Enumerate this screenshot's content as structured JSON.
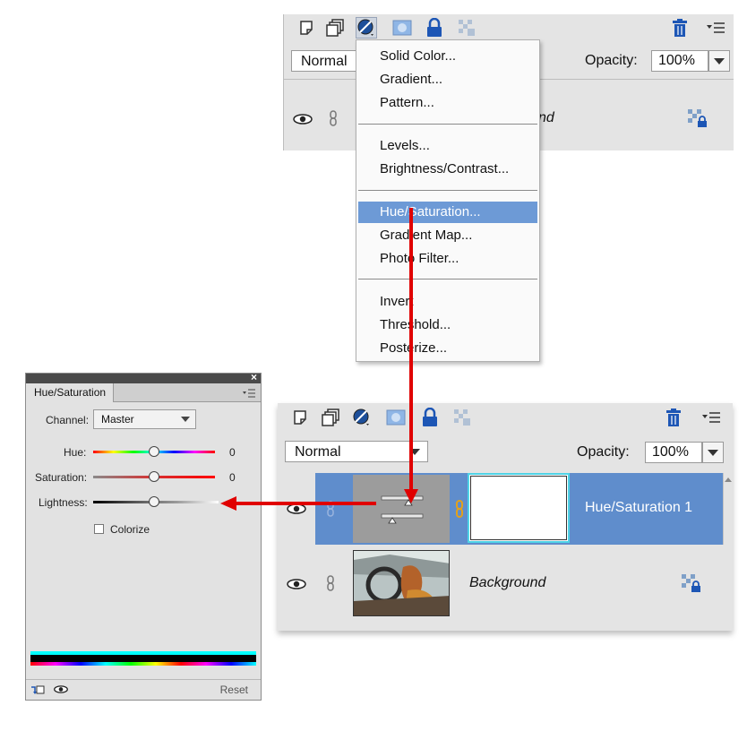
{
  "top_panel": {
    "blend_mode": "Normal",
    "opacity_label": "Opacity:",
    "opacity_value": "100%",
    "layer_name_partial": "nd"
  },
  "menu": {
    "items": [
      {
        "label": "Solid Color..."
      },
      {
        "label": "Gradient..."
      },
      {
        "label": "Pattern..."
      },
      {
        "label": "Levels..."
      },
      {
        "label": "Brightness/Contrast..."
      },
      {
        "label": "Hue/Saturation...",
        "selected": true
      },
      {
        "label": "Gradient Map..."
      },
      {
        "label": "Photo Filter..."
      },
      {
        "label": "Invert"
      },
      {
        "label": "Threshold..."
      },
      {
        "label": "Posterize..."
      }
    ]
  },
  "bottom_panel": {
    "blend_mode": "Normal",
    "opacity_label": "Opacity:",
    "opacity_value": "100%",
    "layers": [
      {
        "name": "Hue/Saturation 1"
      },
      {
        "name": "Background"
      }
    ]
  },
  "hue_saturation": {
    "tab_title": "Hue/Saturation",
    "channel_label": "Channel:",
    "channel_value": "Master",
    "hue_label": "Hue:",
    "hue_value": "0",
    "saturation_label": "Saturation:",
    "saturation_value": "0",
    "lightness_label": "Lightness:",
    "colorize_label": "Colorize",
    "colorize_checked": false,
    "reset_label": "Reset"
  },
  "colors": {
    "accent_arrow": "#e00000",
    "selected_layer": "#5f8dcc",
    "menu_highlight": "#6d9ad6"
  }
}
